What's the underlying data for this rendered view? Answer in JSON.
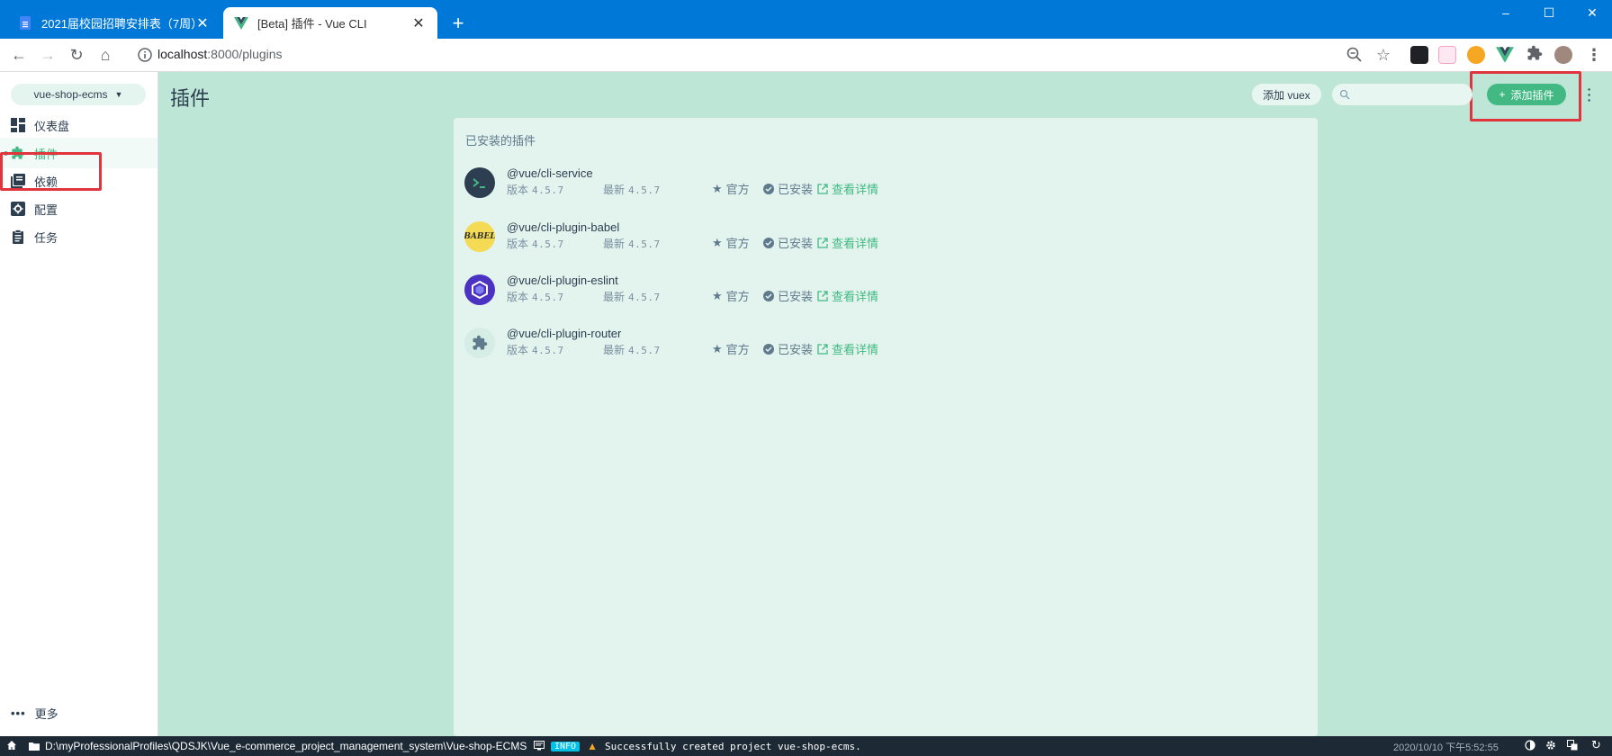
{
  "browser": {
    "tabs": [
      {
        "title": "2021届校园招聘安排表（7周）",
        "close": "✕",
        "active": false
      },
      {
        "title": "[Beta] 插件 - Vue CLI",
        "close": "✕",
        "active": true
      }
    ],
    "new_tab": "+",
    "window_controls": {
      "minimize": "–",
      "maximize": "☐",
      "close": "✕"
    },
    "address": {
      "host": "localhost",
      "path": ":8000/plugins"
    }
  },
  "sidebar": {
    "project": "vue-shop-ecms",
    "items": [
      {
        "label": "仪表盘",
        "icon": "dashboard-icon",
        "active": false
      },
      {
        "label": "插件",
        "icon": "puzzle-icon",
        "active": true
      },
      {
        "label": "依赖",
        "icon": "library-books-icon",
        "active": false
      },
      {
        "label": "配置",
        "icon": "settings-applications-icon",
        "active": false
      },
      {
        "label": "任务",
        "icon": "assignment-icon",
        "active": false
      }
    ],
    "more": "更多"
  },
  "header": {
    "title": "插件",
    "add_vuex": "添加 vuex",
    "search_placeholder": "",
    "add_plugin": "添加插件"
  },
  "panel": {
    "title": "已安装的插件",
    "plugins": [
      {
        "name": "@vue/cli-service",
        "version_label": "版本",
        "version": "4.5.7",
        "latest_label": "最新",
        "latest": "4.5.7",
        "official": "官方",
        "installed": "已安装",
        "details": "查看详情"
      },
      {
        "name": "@vue/cli-plugin-babel",
        "version_label": "版本",
        "version": "4.5.7",
        "latest_label": "最新",
        "latest": "4.5.7",
        "official": "官方",
        "installed": "已安装",
        "details": "查看详情"
      },
      {
        "name": "@vue/cli-plugin-eslint",
        "version_label": "版本",
        "version": "4.5.7",
        "latest_label": "最新",
        "latest": "4.5.7",
        "official": "官方",
        "installed": "已安装",
        "details": "查看详情"
      },
      {
        "name": "@vue/cli-plugin-router",
        "version_label": "版本",
        "version": "4.5.7",
        "latest_label": "最新",
        "latest": "4.5.7",
        "official": "官方",
        "installed": "已安装",
        "details": "查看详情"
      }
    ]
  },
  "statusbar": {
    "path": "D:\\myProfessionalProfiles\\QDSJK\\Vue_e-commerce_project_management_system\\Vue-shop-ECMS",
    "log_level": "INFO",
    "log_message": "Successfully created project vue-shop-ecms.",
    "datetime": "2020/10/10  下午5:52:55"
  },
  "colors": {
    "accent": "#42b983",
    "background": "#bde6d7",
    "panel": "#e3f4ee",
    "statusbar": "#1d2935",
    "browser_chrome": "#0078d7",
    "highlight_box": "#e0353f"
  }
}
